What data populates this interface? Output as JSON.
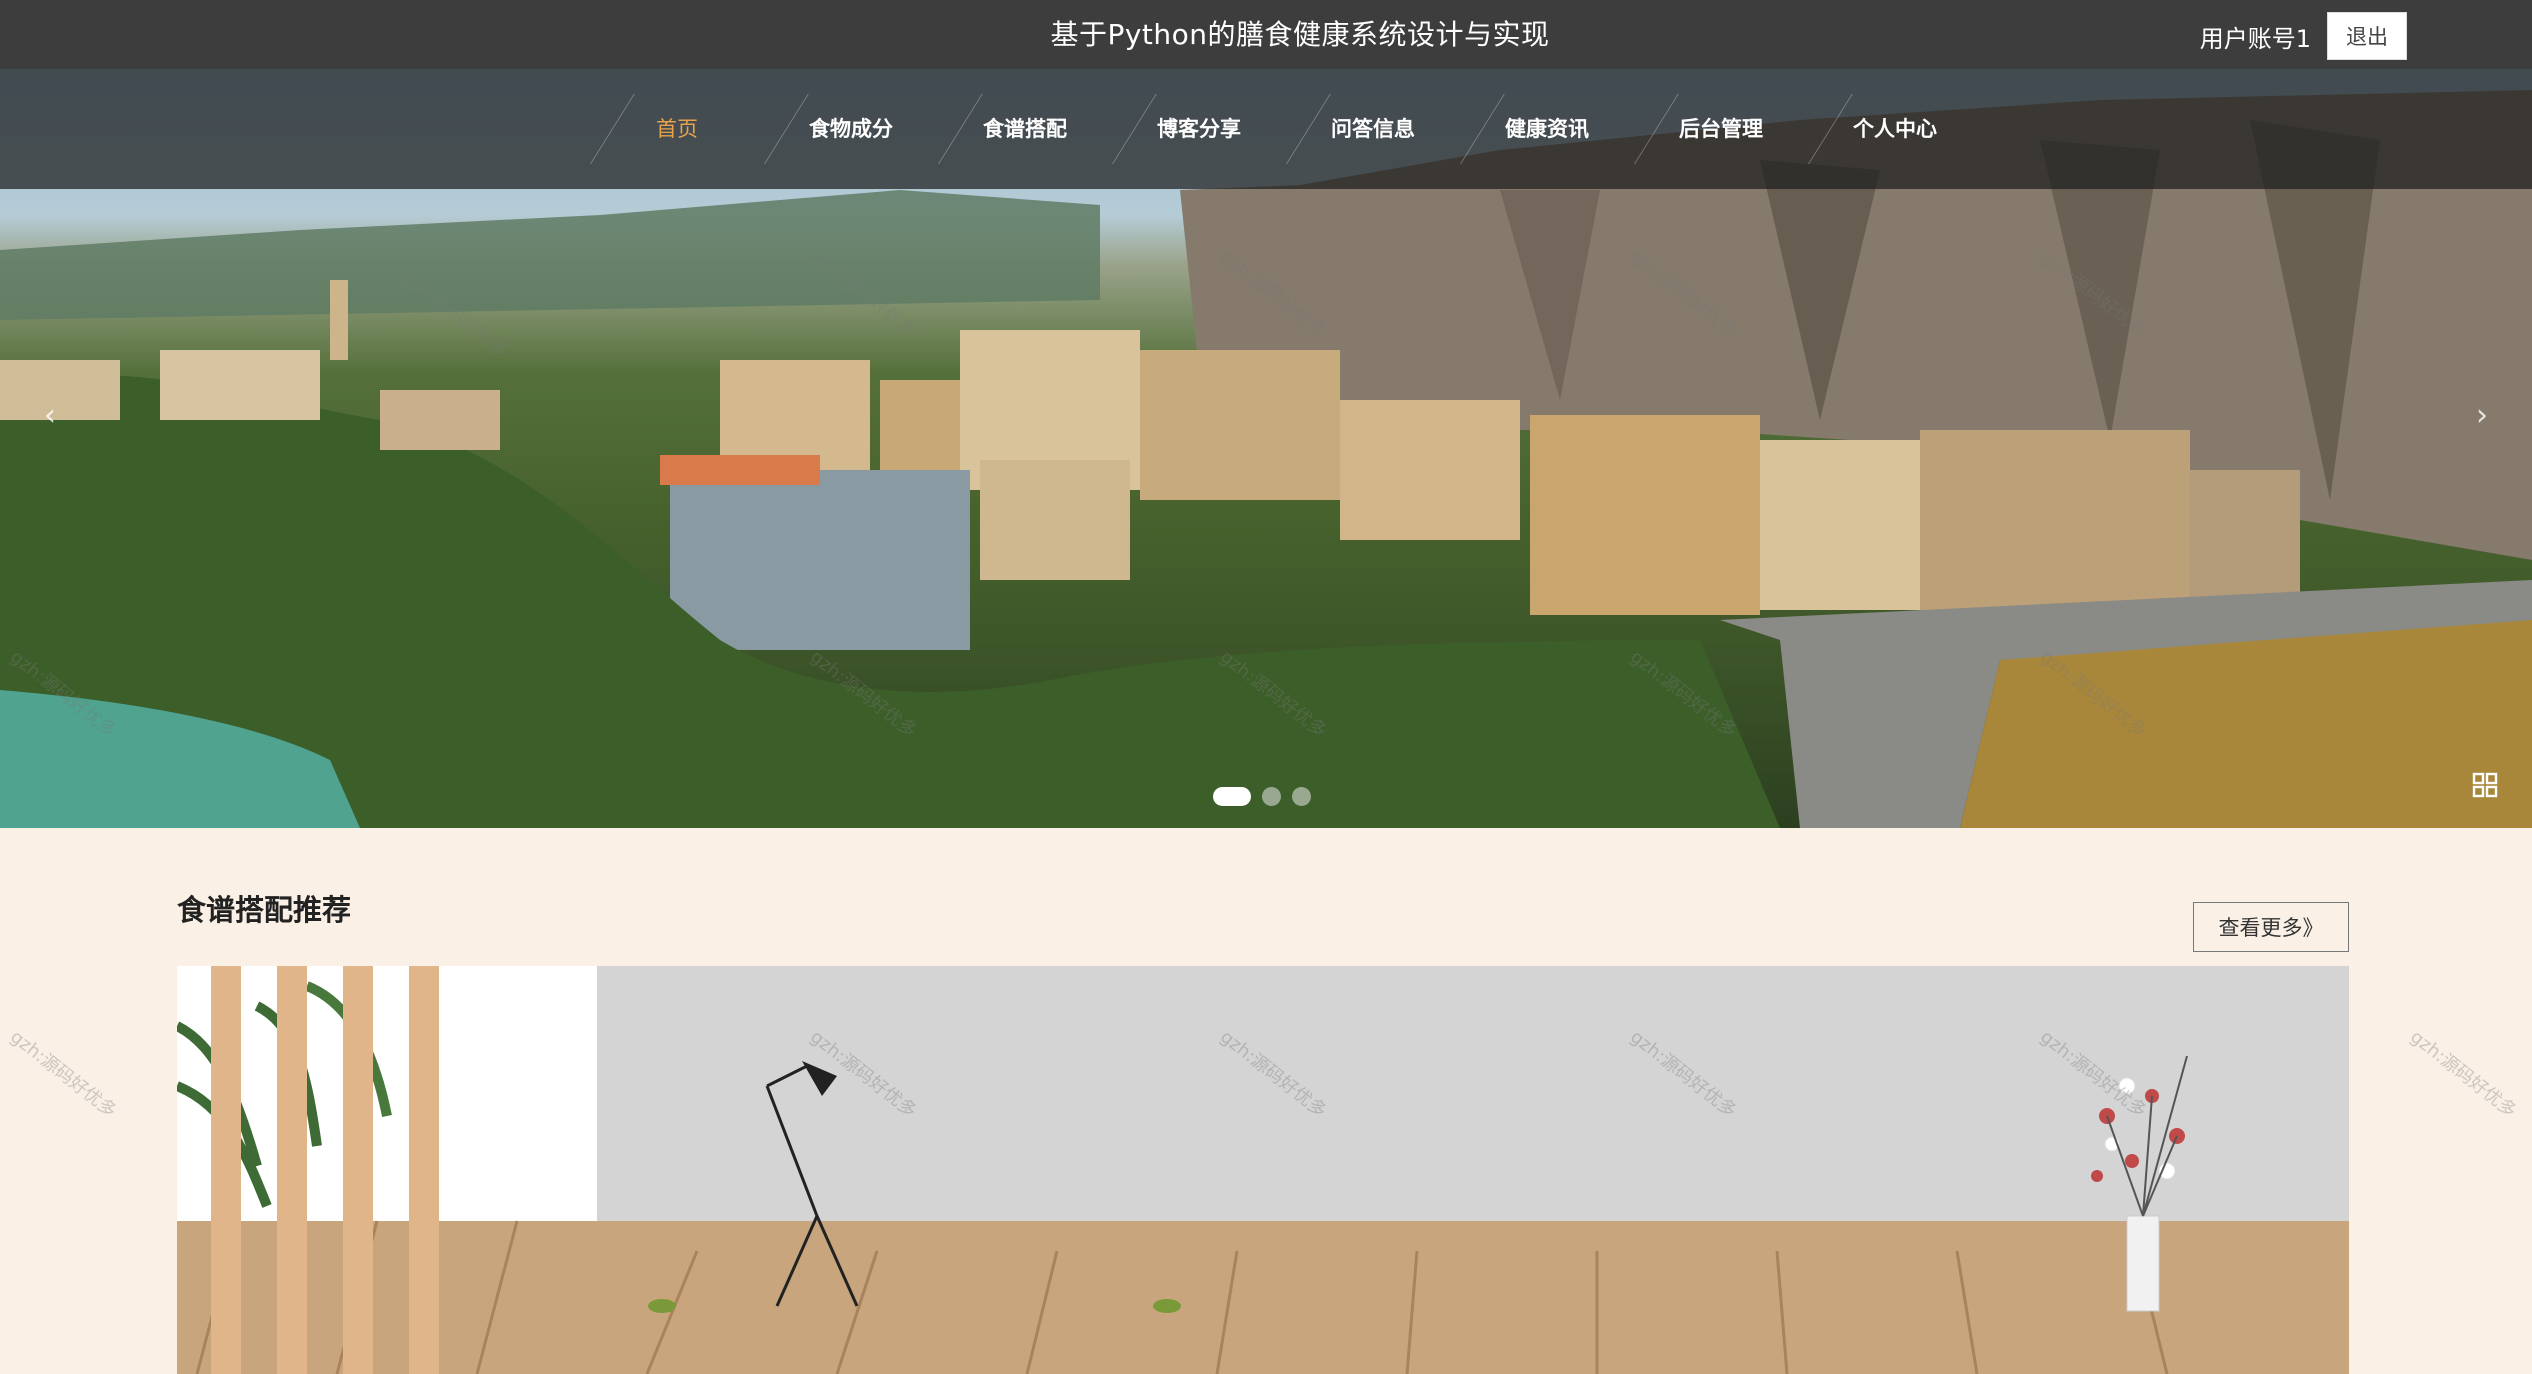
{
  "header": {
    "site_title": "基于Python的膳食健康系统设计与实现",
    "user_name": "用户账号1",
    "logout_label": "退出"
  },
  "nav": {
    "items": [
      {
        "label": "首页",
        "active": true
      },
      {
        "label": "食物成分",
        "active": false
      },
      {
        "label": "食谱搭配",
        "active": false
      },
      {
        "label": "博客分享",
        "active": false
      },
      {
        "label": "问答信息",
        "active": false
      },
      {
        "label": "健康资讯",
        "active": false
      },
      {
        "label": "后台管理",
        "active": false
      },
      {
        "label": "个人中心",
        "active": false
      }
    ],
    "active_color": "#e8a24a"
  },
  "carousel": {
    "slide_count": 3,
    "active_index": 0
  },
  "recipe_section": {
    "title": "食谱搭配推荐",
    "more_label": "查看更多》"
  },
  "colors": {
    "topbar": "#3d3d3d",
    "page_background": "#faf0e6"
  },
  "watermark": "gzh:源码好优多"
}
